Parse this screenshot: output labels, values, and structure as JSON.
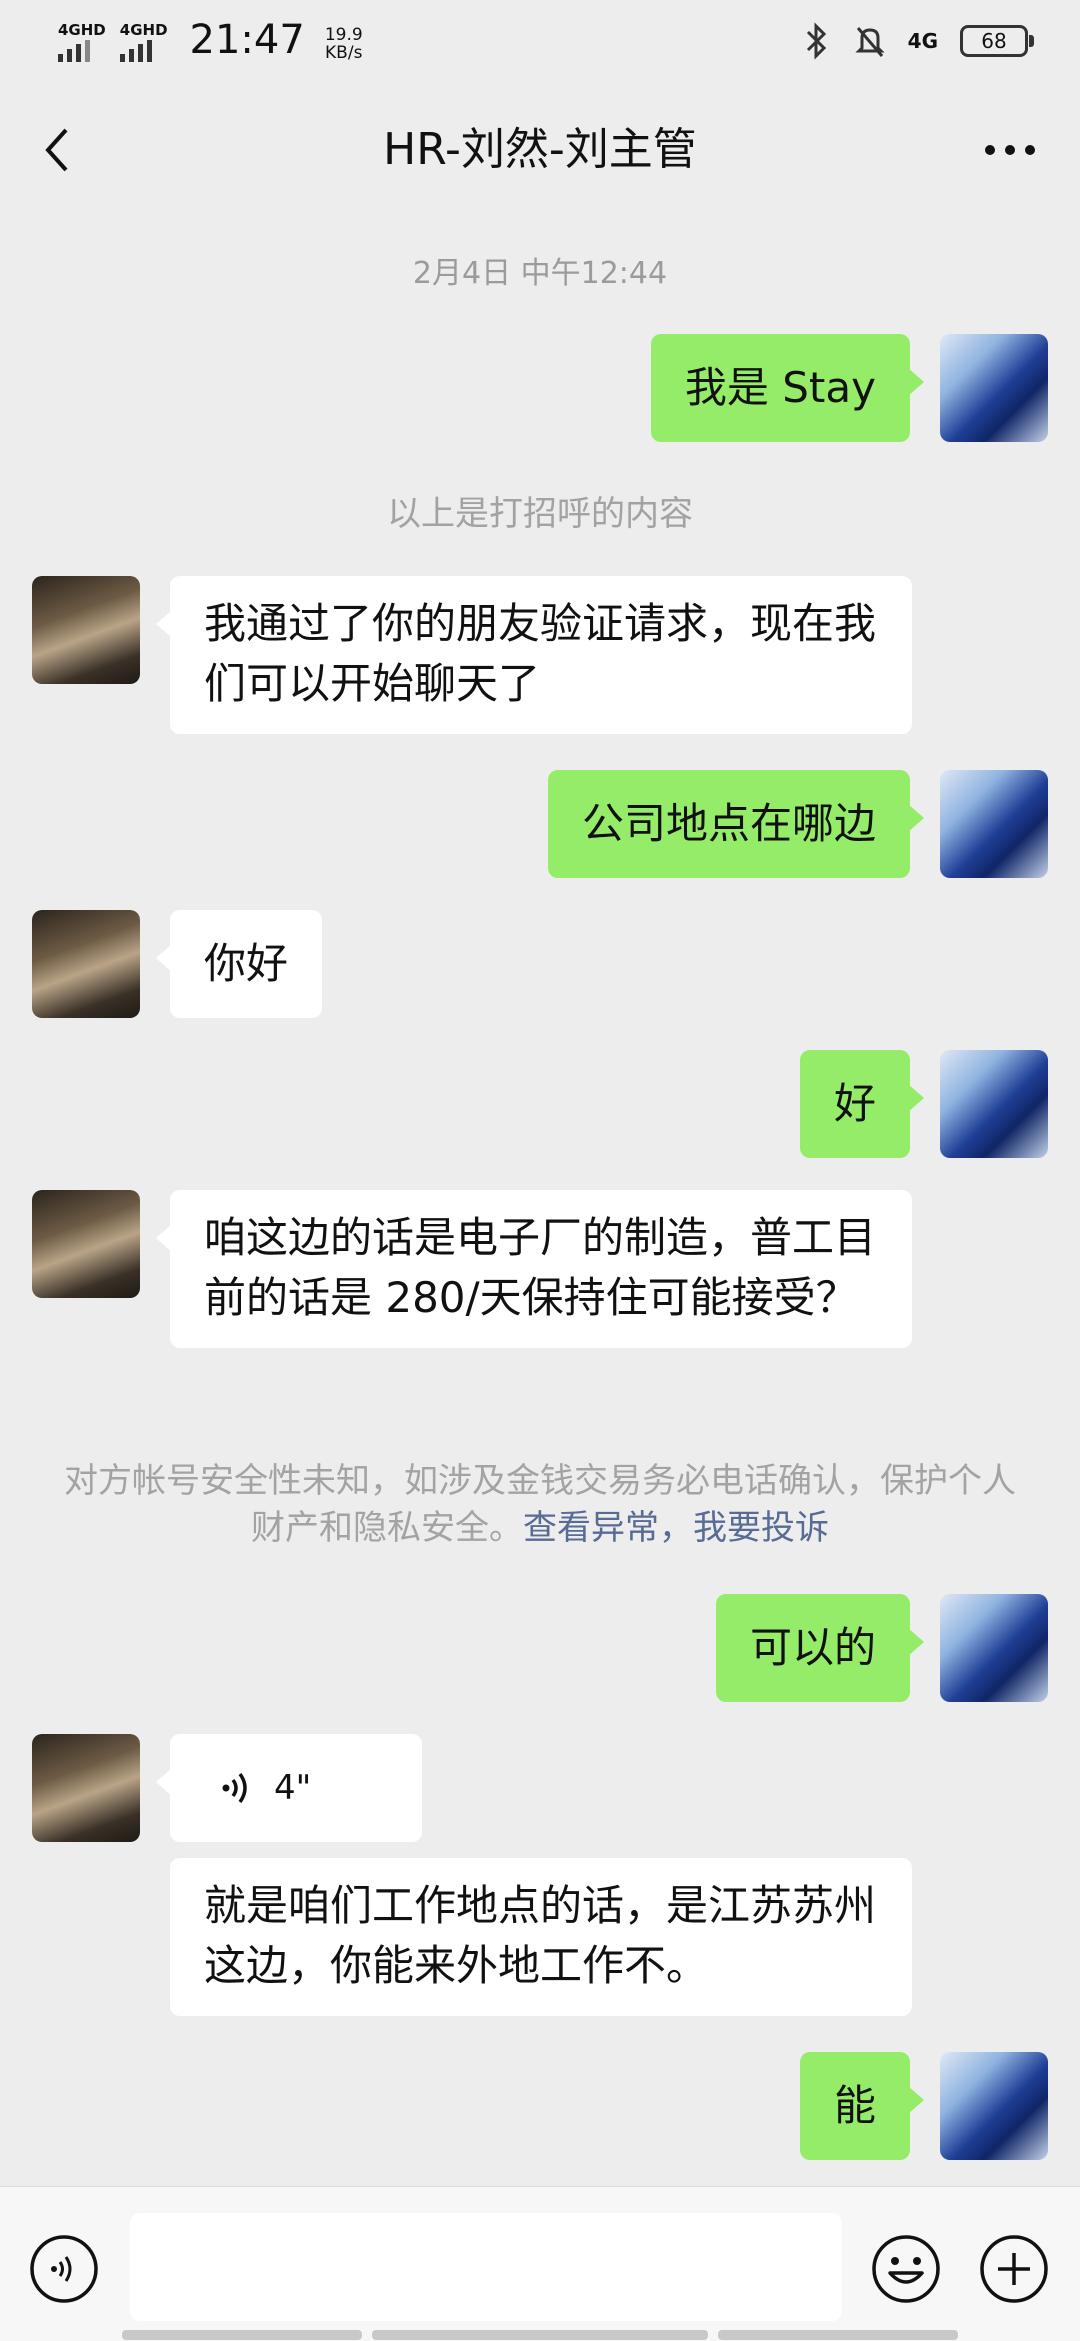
{
  "status_bar": {
    "signal1": "4GHD",
    "signal2": "4GHD",
    "time": "21:47",
    "speed_value": "19.9",
    "speed_unit": "KB/s",
    "network": "4G",
    "battery": "68",
    "icons": [
      "bluetooth-icon",
      "mute-icon",
      "network-4g-icon",
      "battery-icon"
    ]
  },
  "header": {
    "title": "HR-刘然-刘主管",
    "back_icon": "chevron-left-icon",
    "more_icon": "ellipsis-icon"
  },
  "chat": {
    "timestamp": "2月4日 中午12:44",
    "greeting_notice": "以上是打招呼的内容",
    "warning_text": "对方帐号安全性未知，如涉及金钱交易务必电话确认，保护个人财产和隐私安全。",
    "warning_link1": "查看异常",
    "warning_sep": "，",
    "warning_link2": "我要投诉",
    "messages": [
      {
        "from": "me",
        "text": "我是 Stay"
      },
      {
        "from": "other",
        "text": "我通过了你的朋友验证请求，现在我们可以开始聊天了"
      },
      {
        "from": "me",
        "text": "公司地点在哪边"
      },
      {
        "from": "other",
        "text": "你好"
      },
      {
        "from": "me",
        "text": "好"
      },
      {
        "from": "other",
        "text": "咱这边的话是电子厂的制造，普工目前的话是 280/天保持住可能接受？"
      },
      {
        "from": "me",
        "text": "可以的"
      },
      {
        "from": "other",
        "type": "voice",
        "duration": "4\""
      },
      {
        "from": "other",
        "text": "就是咱们工作地点的话，是江苏苏州这边，你能来外地工作不。"
      },
      {
        "from": "me",
        "text": "能"
      }
    ]
  },
  "input_bar": {
    "voice_icon": "voice-input-icon",
    "emoji_icon": "emoji-icon",
    "plus_icon": "plus-icon"
  }
}
